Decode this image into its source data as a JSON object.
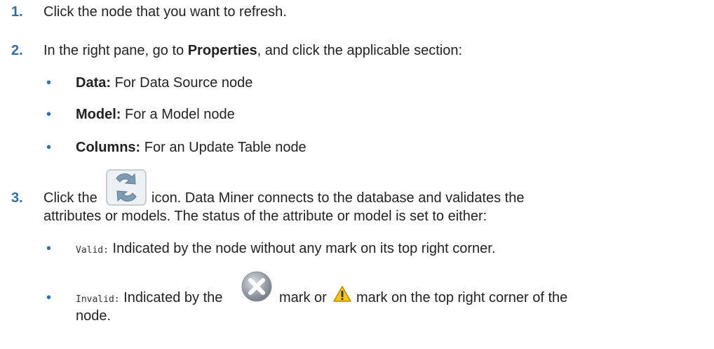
{
  "steps": [
    {
      "number": "1.",
      "text": "Click the node that you want to refresh."
    },
    {
      "number": "2.",
      "prefix": "In the right pane, go to ",
      "bold": "Properties",
      "suffix": ", and click the applicable section:"
    },
    {
      "number": "3.",
      "prefix": "Click the",
      "suffix": "icon. Data Miner connects to the database and validates the",
      "line2": "attributes or models. The status of the attribute or model is set to either:"
    }
  ],
  "sections": [
    {
      "bold": "Data:",
      "text": " For Data Source node"
    },
    {
      "bold": "Model:",
      "text": " For a Model node"
    },
    {
      "bold": "Columns:",
      "text": " For an Update Table node"
    }
  ],
  "statuses": [
    {
      "code": "Valid:",
      "text": " Indicated by the node without any mark on its top right corner."
    },
    {
      "code": "Invalid:",
      "text_before": " Indicated by the",
      "text_mid": "mark or",
      "text_after": "mark on the top right corner of the",
      "line2": "node."
    }
  ],
  "icons": {
    "refresh": "refresh-icon",
    "error": "error-x-icon",
    "warning": "warning-icon"
  },
  "colors": {
    "step_number": "#2f6fae",
    "bullet": "#2f6fae",
    "text": "#222222"
  }
}
